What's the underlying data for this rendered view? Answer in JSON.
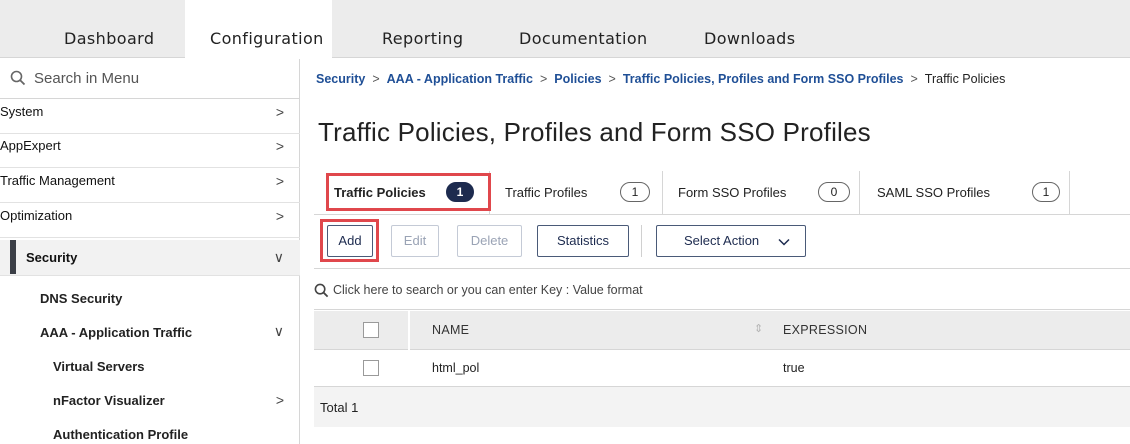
{
  "topnav": {
    "tabs": [
      {
        "label": "Dashboard"
      },
      {
        "label": "Configuration"
      },
      {
        "label": "Reporting"
      },
      {
        "label": "Documentation"
      },
      {
        "label": "Downloads"
      }
    ],
    "active": "Configuration"
  },
  "sidebar": {
    "search_placeholder": "Search in Menu",
    "items": [
      {
        "label": "System",
        "chevron": ">"
      },
      {
        "label": "AppExpert",
        "chevron": ">"
      },
      {
        "label": "Traffic Management",
        "chevron": ">"
      },
      {
        "label": "Optimization",
        "chevron": ">"
      },
      {
        "label": "Security",
        "chevron": "∨"
      },
      {
        "label": "DNS Security",
        "chevron": ""
      },
      {
        "label": "AAA - Application Traffic",
        "chevron": "∨"
      },
      {
        "label": "Virtual Servers",
        "chevron": ""
      },
      {
        "label": "nFactor Visualizer",
        "chevron": ">"
      },
      {
        "label": "Authentication Profile",
        "chevron": ""
      }
    ]
  },
  "breadcrumb": {
    "items": [
      "Security",
      "AAA - Application Traffic",
      "Policies",
      "Traffic Policies, Profiles and Form SSO Profiles",
      "Traffic Policies"
    ],
    "separator": ">"
  },
  "page": {
    "title": "Traffic Policies, Profiles and Form SSO Profiles"
  },
  "tabs": [
    {
      "label": "Traffic Policies",
      "count": "1"
    },
    {
      "label": "Traffic Profiles",
      "count": "1"
    },
    {
      "label": "Form SSO Profiles",
      "count": "0"
    },
    {
      "label": "SAML SSO Profiles",
      "count": "1"
    }
  ],
  "toolbar": {
    "add_label": "Add",
    "edit_label": "Edit",
    "delete_label": "Delete",
    "statistics_label": "Statistics",
    "select_action_label": "Select Action"
  },
  "table": {
    "search_placeholder": "Click here to search or you can enter Key : Value format",
    "columns": [
      "NAME",
      "EXPRESSION"
    ],
    "rows": [
      {
        "name": "html_pol",
        "expression": "true"
      }
    ],
    "total_label": "Total 1"
  },
  "colors": {
    "accent": "#1d2b4f",
    "link": "#1f4f96",
    "highlight": "#e0474c"
  }
}
